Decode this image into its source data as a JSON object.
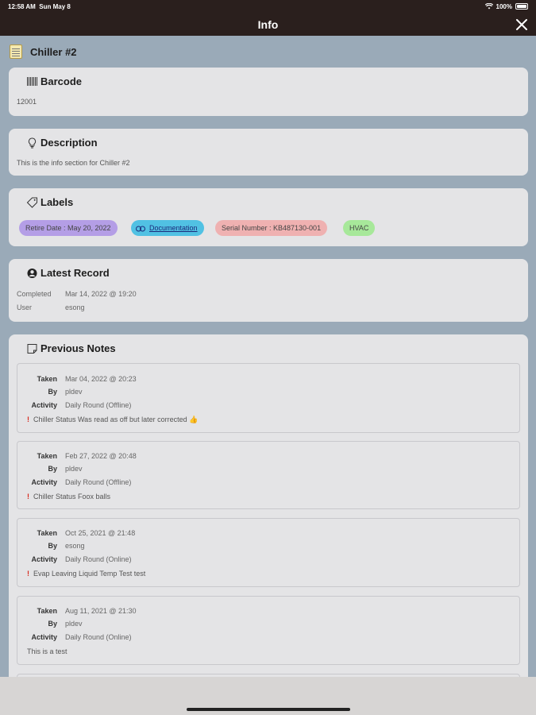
{
  "status_bar": {
    "time": "12:58 AM",
    "date": "Sun May 8",
    "wifi_icon": "wifi-icon",
    "battery_percent": "100%",
    "battery_level": 1.0
  },
  "nav": {
    "title": "Info",
    "close_icon": "close-icon"
  },
  "asset": {
    "icon": "notepad-icon",
    "name": "Chiller #2"
  },
  "barcode": {
    "icon": "barcode-icon",
    "title": "Barcode",
    "value": "12001"
  },
  "description": {
    "icon": "lightbulb-icon",
    "title": "Description",
    "text": "This is the info section for Chiller #2"
  },
  "labels": {
    "icon": "tag-icon",
    "title": "Labels",
    "chips": [
      {
        "text": "Retire Date : May 20, 2022",
        "color": "#b49ee6"
      },
      {
        "text": "Documentation",
        "color": "#51c1e3",
        "icon": "link-icon"
      },
      {
        "text": "Serial Number : KB487130-001",
        "color": "#efb1b1"
      },
      {
        "text": "HVAC",
        "color": "#a7e89a"
      }
    ]
  },
  "latest_record": {
    "icon": "user-circle-icon",
    "title": "Latest Record",
    "completed_label": "Completed",
    "completed_value": "Mar 14, 2022 @ 19:20",
    "user_label": "User",
    "user_value": "esong"
  },
  "previous_notes": {
    "icon": "note-icon",
    "title": "Previous Notes",
    "taken_label": "Taken",
    "by_label": "By",
    "activity_label": "Activity",
    "notes": [
      {
        "taken": "Mar 04, 2022 @ 20:23",
        "by": "pldev",
        "activity": "Daily Round (Offline)",
        "text": "Chiller Status Was read as off but later corrected 👍",
        "flag": "!"
      },
      {
        "taken": "Feb 27, 2022 @ 20:48",
        "by": "pldev",
        "activity": "Daily Round (Offline)",
        "text": "Chiller Status Foox balls",
        "flag": "!"
      },
      {
        "taken": "Oct 25, 2021 @ 21:48",
        "by": "esong",
        "activity": "Daily Round (Online)",
        "text": "Evap Leaving Liquid Temp Test test",
        "flag": "!"
      },
      {
        "taken": "Aug 11, 2021 @ 21:30",
        "by": "pldev",
        "activity": "Daily Round (Online)",
        "text": "This is a test",
        "flag": ""
      }
    ]
  }
}
